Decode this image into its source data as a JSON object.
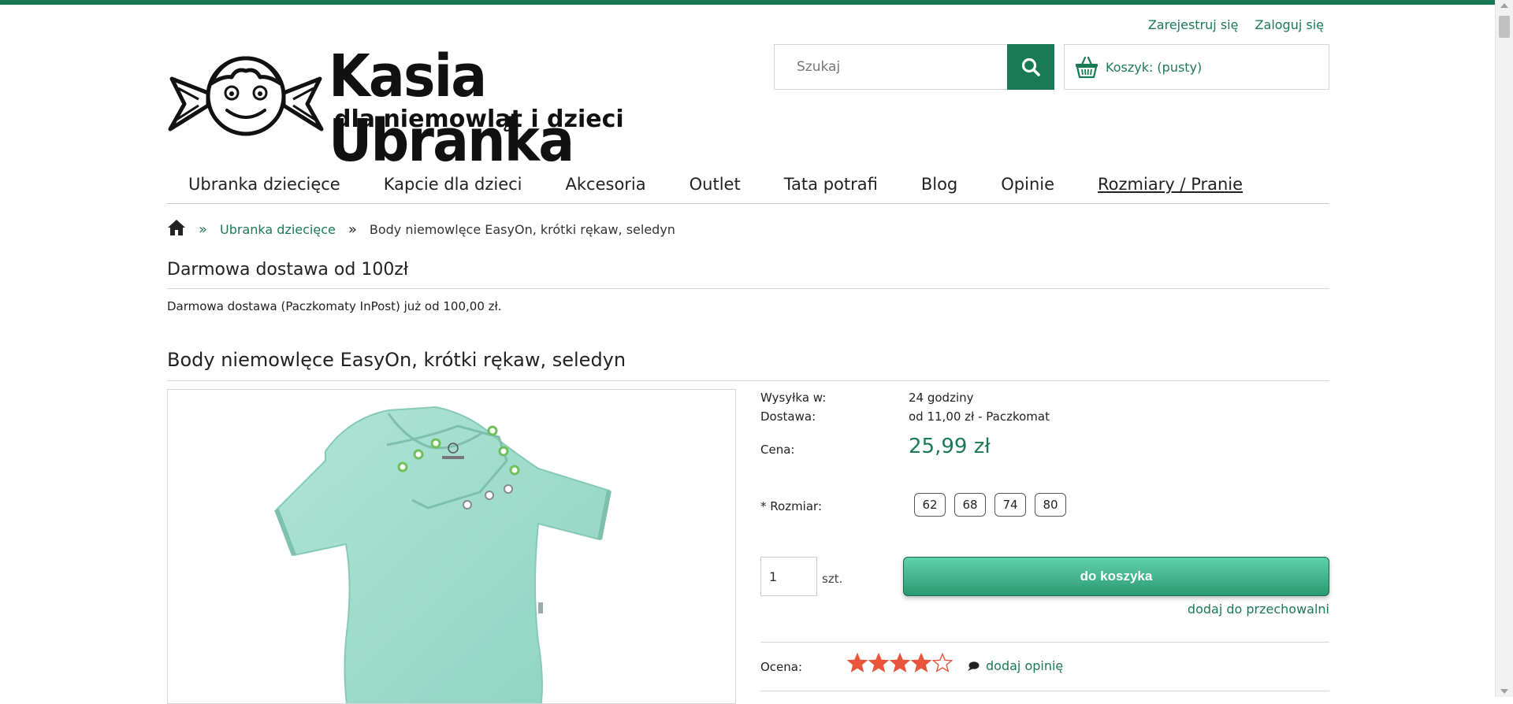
{
  "colors": {
    "accent": "#1a7a55",
    "star": "#e8553a",
    "button_top": "#5fd1ac",
    "button_bottom": "#2a9a72"
  },
  "header": {
    "register_label": "Zarejestruj się",
    "login_label": "Zaloguj się",
    "logo": {
      "brand": "Kasia Ubranka",
      "tagline": "dla niemowląt i dzieci"
    },
    "search": {
      "placeholder": "Szukaj",
      "icon": "search-icon"
    },
    "cart": {
      "label": "Koszyk: (pusty)",
      "icon": "basket-icon"
    }
  },
  "nav": {
    "items": [
      {
        "label": "Ubranka dziecięce"
      },
      {
        "label": "Kapcie dla dzieci"
      },
      {
        "label": "Akcesoria"
      },
      {
        "label": "Outlet"
      },
      {
        "label": "Tata potrafi"
      },
      {
        "label": "Blog"
      },
      {
        "label": "Opinie"
      },
      {
        "label": "Rozmiary / Pranie"
      }
    ]
  },
  "breadcrumb": {
    "home_icon": "home-icon",
    "separator": "»",
    "category": "Ubranka dziecięce",
    "current": "Body niemowlęce EasyOn, krótki rękaw, seledyn"
  },
  "notice": {
    "title": "Darmowa dostawa od 100zł",
    "text": "Darmowa dostawa (Paczkomaty InPost) już od 100,00 zł."
  },
  "product": {
    "title": "Body niemowlęce EasyOn, krótki rękaw, seledyn",
    "shipping_label": "Wysyłka w:",
    "shipping_value": "24 godziny",
    "delivery_label": "Dostawa:",
    "delivery_value": "od 11,00 zł - Paczkomat",
    "price_label": "Cena:",
    "price_value": "25,99 zł",
    "size_label": "* Rozmiar:",
    "sizes": [
      "62",
      "68",
      "74",
      "80"
    ],
    "quantity_value": "1",
    "quantity_unit": "szt.",
    "add_to_cart_label": "do koszyka",
    "wishlist_label": "dodaj do przechowalni",
    "rating_label": "Ocena:",
    "rating_value": 4,
    "rating_max": 5,
    "add_review_label": "dodaj opinię",
    "add_review_icon": "chat-icon"
  }
}
